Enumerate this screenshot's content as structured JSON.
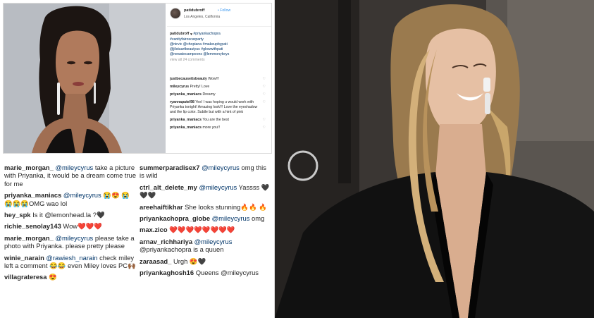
{
  "post": {
    "username": "patidubroff",
    "follow_label": "• Follow",
    "location": "Los Angeles, California",
    "caption_user": "patidubroff",
    "caption_lines": [
      "#priyankachopra",
      "#vanityfairoscarparty",
      "@nirvic @chopiana #makeupbypati",
      "@jilstuartbeautyus #glowwithpati",
      "@newatecampoons @lemmonykeys"
    ],
    "view_all": "view all 24 comments",
    "comments": [
      {
        "user": "justbecauseitsbeauty",
        "text": "Wow!!!"
      },
      {
        "user": "mileycyrus",
        "text": "Pretty! Love"
      },
      {
        "user": "priyanka_maniacs",
        "text": "Dreamy"
      },
      {
        "user": "ryannapatel98",
        "text": "Yes! I was hoping u would work with Priyanka tonight! Amazing look!!! Love the eyeshadow and the lip color. Subtle but with a hint of pink"
      },
      {
        "user": "priyanka_maniacs",
        "text": "You are the best"
      },
      {
        "user": "priyanka_maniacs",
        "text": "more you!!"
      }
    ]
  },
  "comments_left": [
    {
      "user": "marie_morgan_",
      "mention": "@mileycyrus",
      "text": " take a picture with Priyanka, it would be a dream come true for me"
    },
    {
      "user": "priyanka_maniacs",
      "mention": "@mileycyrus",
      "text": " 😭😍 😭😭😭😭OMG wao lol"
    },
    {
      "user": "hey_spk",
      "mention": "",
      "text": "Is it @lemonhead.la ?🖤"
    },
    {
      "user": "richie_senolay143",
      "mention": "",
      "text": "Wow❤️❤️❤️"
    },
    {
      "user": "marie_morgan_",
      "mention": "@mileycyrus",
      "text": " please take a photo with Priyanka. please pretty please"
    },
    {
      "user": "winie_narain",
      "mention": "@rawiesh_narain",
      "text": " check miley left a comment 😂😂 even Miley loves PC🙌🏾"
    },
    {
      "user": "villagrateresa",
      "mention": "",
      "text": "😍"
    }
  ],
  "comments_right": [
    {
      "user": "summerparadisex7",
      "mention": "@mileycyrus",
      "text": " omg this is wild"
    },
    {
      "user": "ctrl_alt_delete_my",
      "mention": "@mileycyrus",
      "text": " Yassss 🖤🖤🖤"
    },
    {
      "user": "areehaiftikhar",
      "mention": "",
      "text": "She looks stunning🔥🔥 🔥"
    },
    {
      "user": "priyankachopra_globe",
      "mention": "@mileycyrus",
      "text": " omg"
    },
    {
      "user": "max.zico",
      "mention": "",
      "text": "❤️❤️❤️❤️❤️❤️❤️❤️"
    },
    {
      "user": "arnav_richhariya",
      "mention": "@mileycyrus",
      "text": " @priyankachopra is a quuen"
    },
    {
      "user": "zaraasad_",
      "mention": "",
      "text": "Urgh 😍🖤"
    },
    {
      "user": "priyankaghosh16",
      "mention": "",
      "text": "Queens @mileycyrus"
    }
  ],
  "colors": {
    "link": "#003569",
    "follow": "#3897f0",
    "heart": "#d91d1d",
    "text": "#262626"
  }
}
